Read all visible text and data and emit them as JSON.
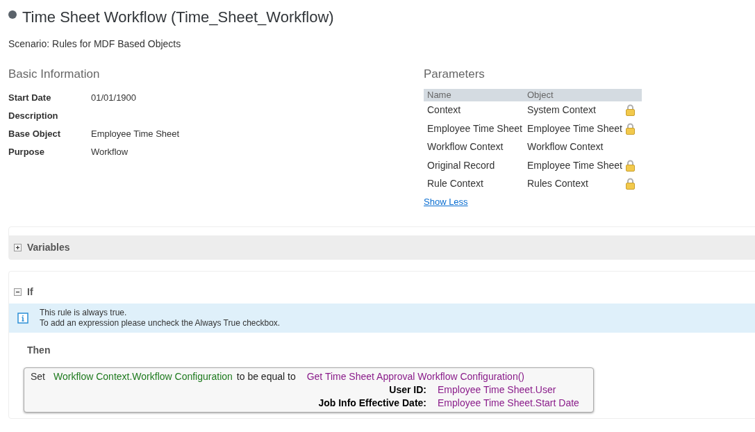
{
  "title": "Time Sheet Workflow (Time_Sheet_Workflow)",
  "scenario": "Scenario: Rules for MDF Based Objects",
  "basic_information": {
    "heading": "Basic Information",
    "fields": [
      {
        "label": "Start Date",
        "value": "01/01/1900"
      },
      {
        "label": "Description"
      },
      {
        "label": "Base Object",
        "value": "Employee Time Sheet"
      },
      {
        "label": "Purpose",
        "value": "Workflow"
      }
    ]
  },
  "parameters": {
    "heading": "Parameters",
    "columns": [
      "Name",
      "Object"
    ],
    "rows": [
      {
        "name": "Context",
        "object": "System Context",
        "locked": true
      },
      {
        "name": "Employee Time Sheet",
        "object": "Employee Time Sheet",
        "locked": true
      },
      {
        "name": "Workflow Context",
        "object": "Workflow Context",
        "locked": false
      },
      {
        "name": "Original Record",
        "object": "Employee Time Sheet",
        "locked": true
      },
      {
        "name": "Rule Context",
        "object": "Rules Context",
        "locked": true
      }
    ],
    "toggle_link": "Show Less"
  },
  "variables": {
    "title": "Variables",
    "expanded": false
  },
  "if_section": {
    "title": "If",
    "expanded": true,
    "info": [
      "This rule is always true.",
      "To add an expression please uncheck the Always True checkbox."
    ],
    "then_label": "Then",
    "action": {
      "verb": "Set",
      "target": "Workflow Context.Workflow Configuration",
      "operator": "to be equal to",
      "function": "Get Time Sheet Approval Workflow Configuration()",
      "arguments": [
        {
          "label": "User ID:",
          "value": "Employee Time Sheet.User"
        },
        {
          "label": "Job Info Effective Date:",
          "value": "Employee Time Sheet.Start Date"
        }
      ]
    }
  }
}
